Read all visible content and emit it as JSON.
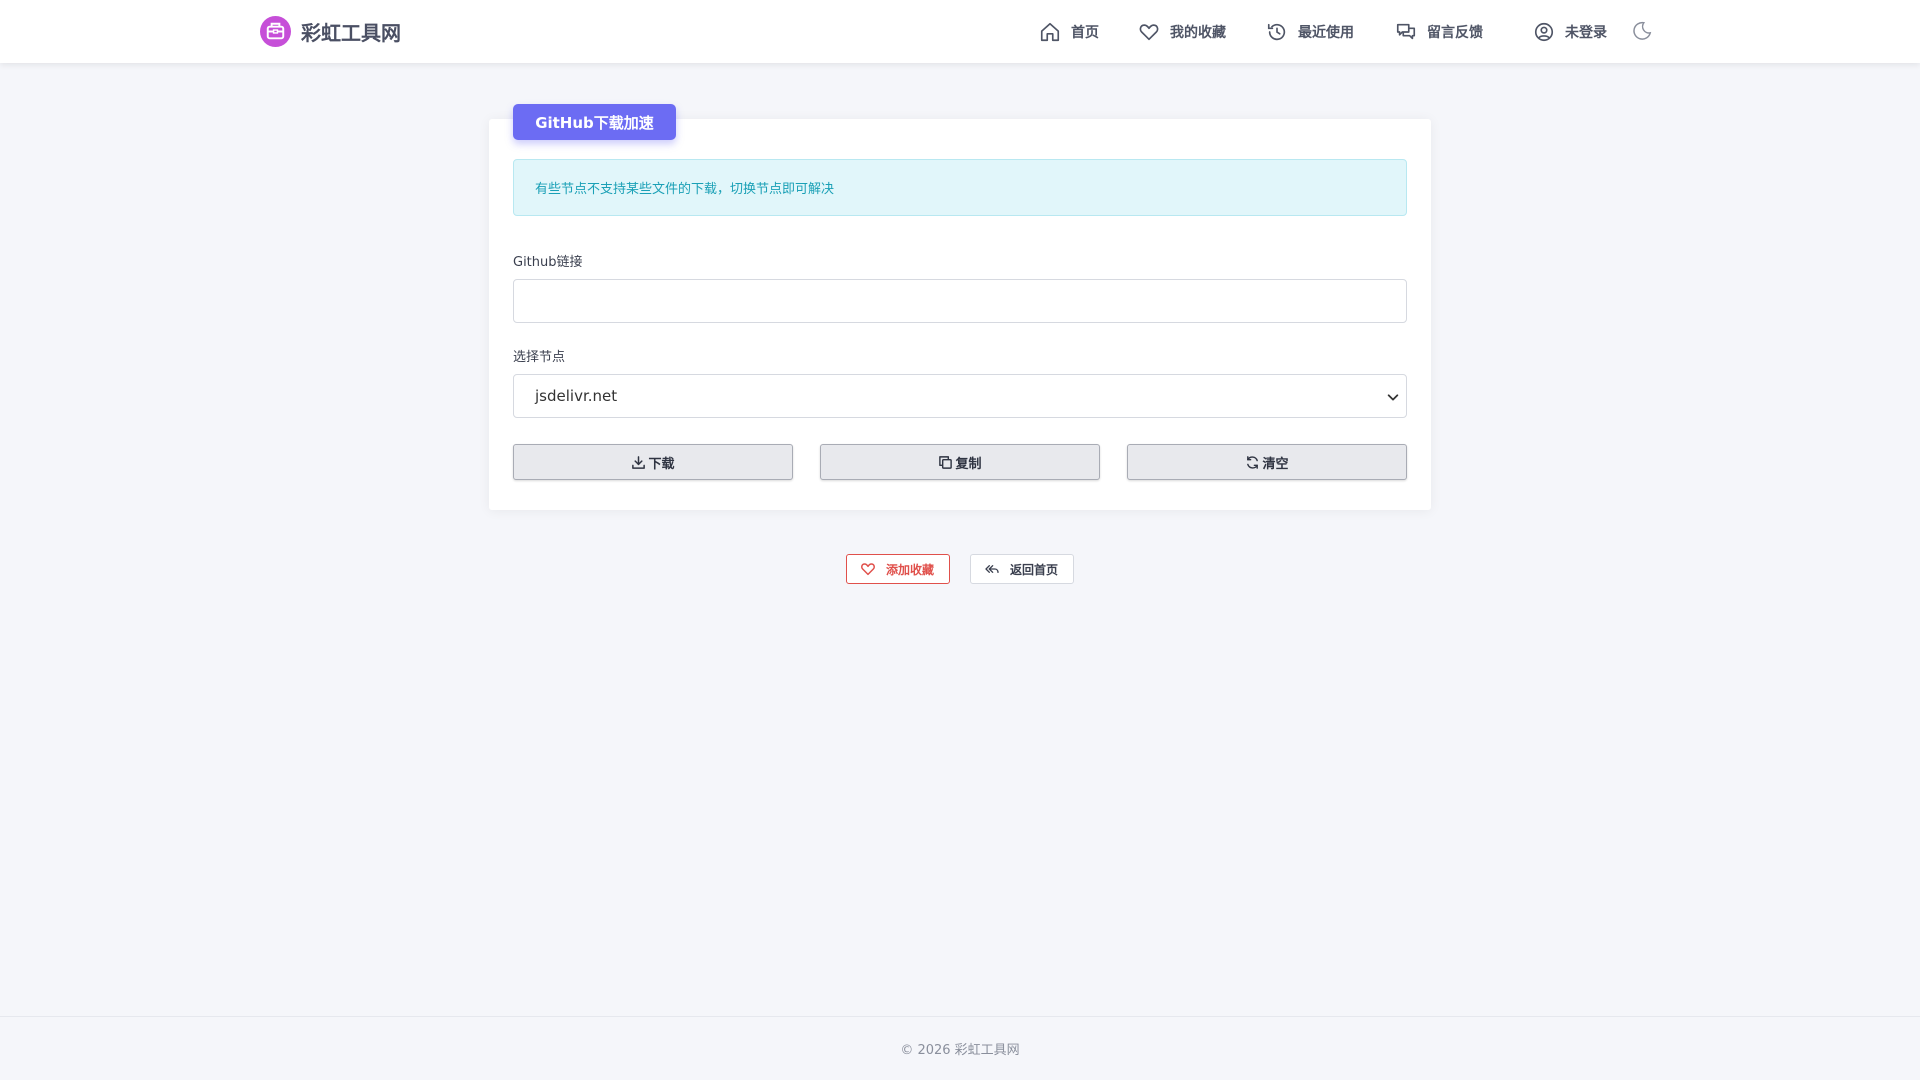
{
  "header": {
    "brand": "彩虹工具网",
    "nav": [
      {
        "label": "首页",
        "icon": "home-icon"
      },
      {
        "label": "我的收藏",
        "icon": "heart-icon"
      },
      {
        "label": "最近使用",
        "icon": "history-icon"
      },
      {
        "label": "留言反馈",
        "icon": "chat-icon"
      },
      {
        "label": "未登录",
        "icon": "user-circle-icon"
      }
    ],
    "theme_icon": "moon-icon"
  },
  "tool": {
    "badge": "GitHub下载加速",
    "alert": "有些节点不支持某些文件的下载，切换节点即可解决",
    "link_label": "Github链接",
    "link_value": "",
    "link_placeholder": "",
    "node_label": "选择节点",
    "node_selected": "jsdelivr.net",
    "buttons": {
      "download": "下载",
      "copy": "复制",
      "clear": "清空"
    }
  },
  "actions": {
    "favorite": "添加收藏",
    "home": "返回首页"
  },
  "footer": {
    "copyright": "© 2026 彩虹工具网"
  },
  "colors": {
    "accent": "#6c6cf3",
    "brand_logo": "#c64fd8",
    "alert_text": "#1aa0b6",
    "alert_bg": "#e1f6fa",
    "favorite": "#e0504b",
    "page_bg": "#f5f6fa"
  }
}
